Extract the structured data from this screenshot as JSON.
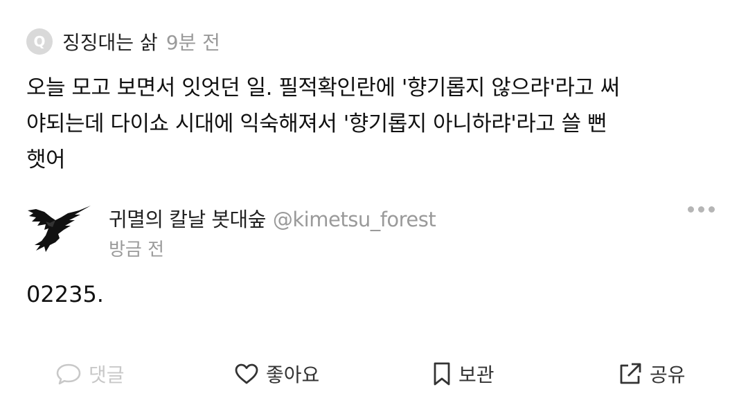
{
  "quote": {
    "badge": "Q",
    "author": "징징대는 삵",
    "time": "9분 전",
    "body": "오늘 모고 보면서 잇엇던 일. 필적확인란에 '향기롭지 않으랴'라고 써\n야되는데 다이쇼 시대에 익숙해져서 '향기롭지 아니하랴'라고 쓸 뻔\n햇어"
  },
  "post": {
    "author_name": "귀멸의 칼날 봇대숲",
    "author_handle": "@kimetsu_forest",
    "time": "방금 전",
    "avatar_icon": "crow-icon",
    "body": "02235."
  },
  "actions": {
    "comment_label": "댓글",
    "like_label": "좋아요",
    "save_label": "보관",
    "share_label": "공유"
  },
  "colors": {
    "text": "#111111",
    "muted": "#9a9a9a",
    "disabled": "#c8c8c8",
    "badge": "#d9d9d9"
  }
}
